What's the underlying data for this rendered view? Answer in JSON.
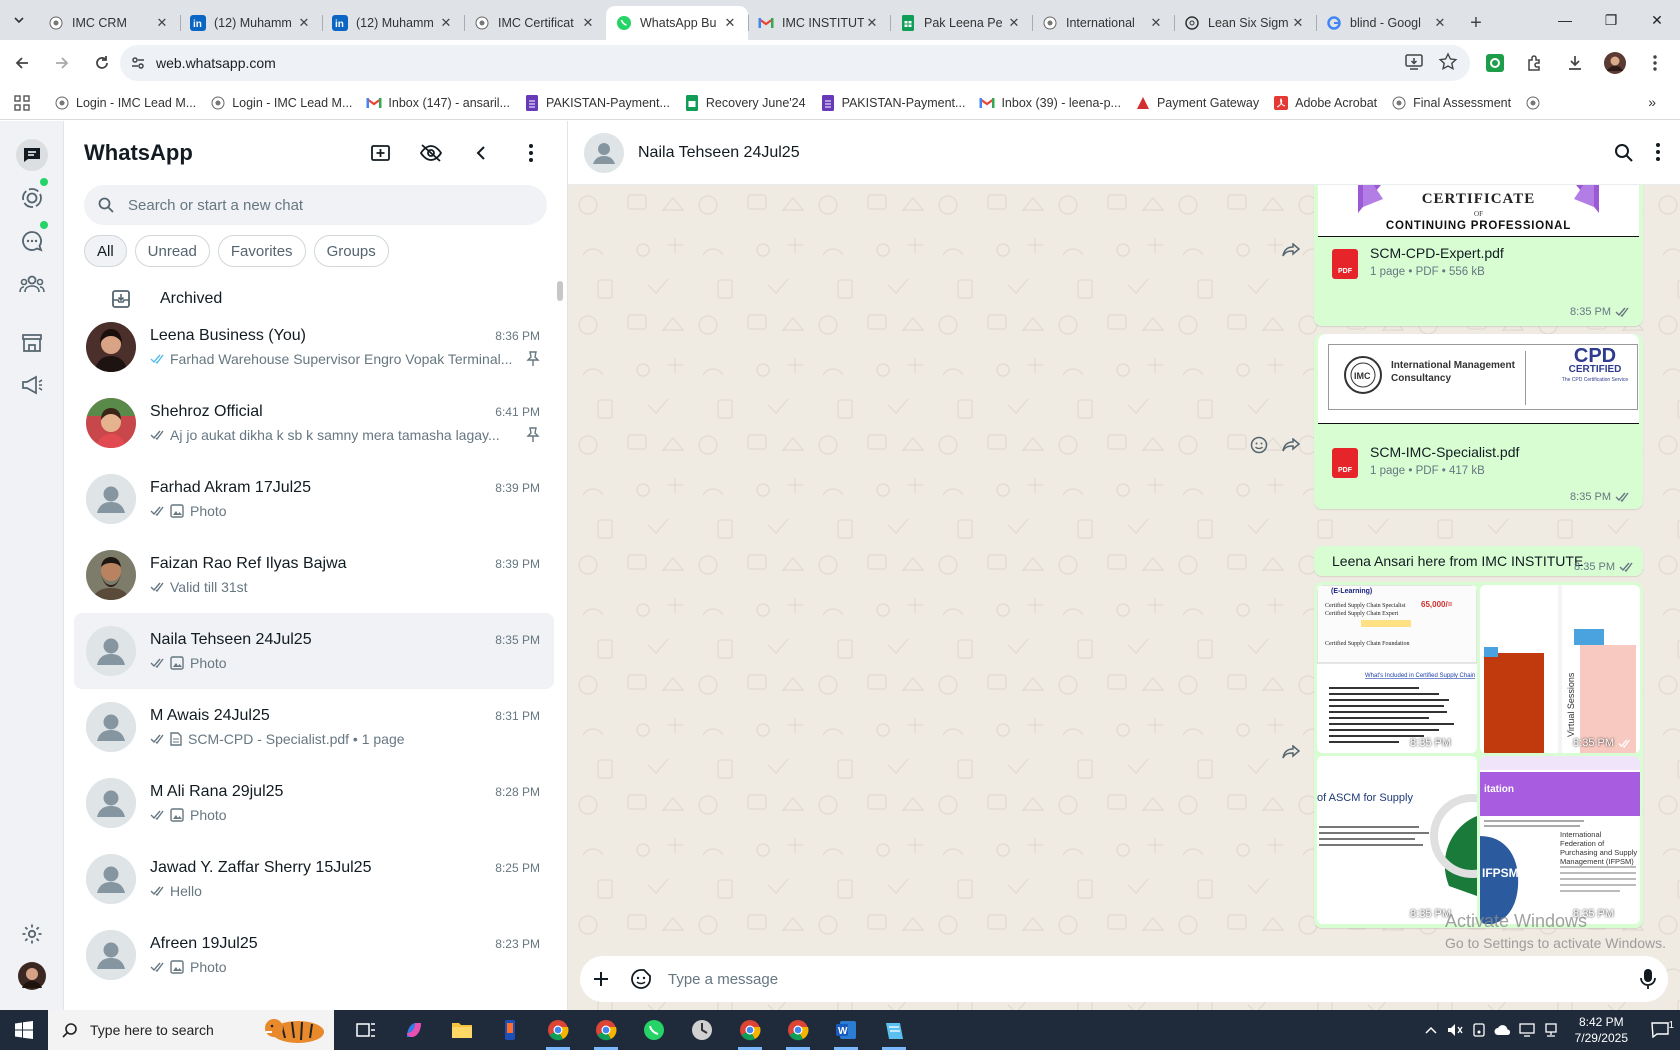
{
  "browser": {
    "tabs": [
      {
        "label": "IMC CRM",
        "icon": "imc-icon"
      },
      {
        "label": "(12) Muhamm",
        "icon": "linkedin-icon"
      },
      {
        "label": "(12) Muhamm",
        "icon": "linkedin-icon"
      },
      {
        "label": "IMC Certificat",
        "icon": "imc-icon"
      },
      {
        "label": "WhatsApp Bu",
        "icon": "whatsapp-icon",
        "active": true
      },
      {
        "label": "IMC INSTITUT",
        "icon": "gmail-icon"
      },
      {
        "label": "Pak Leena Pe",
        "icon": "sheets-icon"
      },
      {
        "label": "International",
        "icon": "imc-icon"
      },
      {
        "label": "Lean Six Sigm",
        "icon": "openai-icon"
      },
      {
        "label": "blind - Googl",
        "icon": "google-icon"
      }
    ],
    "url": "web.whatsapp.com",
    "bookmarks": [
      {
        "label": "Login - IMC Lead M...",
        "icon": "imc-icon"
      },
      {
        "label": "Login - IMC Lead M...",
        "icon": "imc-icon"
      },
      {
        "label": "Inbox (147) - ansaril...",
        "icon": "gmail-icon"
      },
      {
        "label": "PAKISTAN-Payment...",
        "icon": "forms-icon"
      },
      {
        "label": "Recovery June'24",
        "icon": "sheets-icon"
      },
      {
        "label": "PAKISTAN-Payment...",
        "icon": "forms-icon"
      },
      {
        "label": "Inbox (39) - leena-p...",
        "icon": "gmail-icon"
      },
      {
        "label": "Payment Gateway",
        "icon": "gateway-icon"
      },
      {
        "label": "Adobe Acrobat",
        "icon": "acrobat-icon"
      },
      {
        "label": "Final Assessment",
        "icon": "imc-icon"
      }
    ]
  },
  "sidebar": {
    "title": "WhatsApp",
    "search_placeholder": "Search or start a new chat",
    "filters": [
      "All",
      "Unread",
      "Favorites",
      "Groups"
    ],
    "archived_label": "Archived",
    "chats": [
      {
        "name": "Leena Business (You)",
        "time": "8:36 PM",
        "preview": "Farhad Warehouse Supervisor Engro Vopak Terminal...",
        "tick": "blue",
        "media": "",
        "pinned": true,
        "avatar": "photo-woman"
      },
      {
        "name": "Shehroz Official",
        "time": "6:41 PM",
        "preview": "Aj jo aukat dikha k sb k samny mera tamasha lagay...",
        "tick": "grey",
        "media": "",
        "pinned": true,
        "avatar": "photo-child"
      },
      {
        "name": "Farhad Akram 17Jul25",
        "time": "8:39 PM",
        "preview": "Photo",
        "tick": "grey",
        "media": "photo",
        "pinned": false,
        "avatar": "default"
      },
      {
        "name": "Faizan Rao Ref Ilyas Bajwa",
        "time": "8:39 PM",
        "preview": "Valid till 31st",
        "tick": "grey",
        "media": "",
        "pinned": false,
        "avatar": "photo-man"
      },
      {
        "name": "Naila Tehseen 24Jul25",
        "time": "8:35 PM",
        "preview": "Photo",
        "tick": "grey",
        "media": "photo",
        "pinned": false,
        "avatar": "default",
        "selected": true
      },
      {
        "name": "M Awais 24Jul25",
        "time": "8:31 PM",
        "preview": "SCM-CPD - Specialist.pdf • 1 page",
        "tick": "grey",
        "media": "doc",
        "pinned": false,
        "avatar": "default"
      },
      {
        "name": "M Ali Rana 29jul25",
        "time": "8:28 PM",
        "preview": "Photo",
        "tick": "grey",
        "media": "photo",
        "pinned": false,
        "avatar": "default"
      },
      {
        "name": "Jawad Y. Zaffar Sherry 15Jul25",
        "time": "8:25 PM",
        "preview": "Hello",
        "tick": "grey",
        "media": "",
        "pinned": false,
        "avatar": "default"
      },
      {
        "name": "Afreen 19Jul25",
        "time": "8:23 PM",
        "preview": "Photo",
        "tick": "grey",
        "media": "photo",
        "pinned": false,
        "avatar": "default"
      }
    ]
  },
  "conversation": {
    "contact_name": "Naila Tehseen 24Jul25",
    "messages": {
      "doc1": {
        "preview_line1": "CERTIFICATE",
        "preview_line2": "OF",
        "preview_line3": "CONTINUING  PROFESSIONAL",
        "name": "SCM-CPD-Expert.pdf",
        "meta": "1 page • PDF • 556 kB",
        "time": "8:35 PM"
      },
      "doc2": {
        "org_line1": "International Management",
        "org_line2": "Consultancy",
        "badge_top": "CPD",
        "badge_bottom": "CERTIFIED",
        "badge_small": "The CPD Certification Service",
        "name": "SCM-IMC-Specialist.pdf",
        "meta": "1 page • PDF • 417 kB",
        "time": "8:35 PM"
      },
      "text1": {
        "text": "Leena Ansari here from IMC INSTITUTE",
        "time": "8:35 PM"
      },
      "images": [
        {
          "time": "8:35 PM",
          "caption": "(E-Learning)",
          "price": "65,000/="
        },
        {
          "time": "8:35 PM",
          "caption": "Virtual Sessions"
        },
        {
          "time": "8:35 PM",
          "caption": "of ASCM for Supply"
        },
        {
          "time": "8:35 PM",
          "caption": "IFPSM",
          "caption2": "International Federation of Purchasing and Supply Management (IFPSM)",
          "header": "itation"
        }
      ]
    },
    "composer_placeholder": "Type a message",
    "watermark_line1": "Activate Windows",
    "watermark_line2": "Go to Settings to activate Windows."
  },
  "taskbar": {
    "search_placeholder": "Type here to search",
    "time": "8:42 PM",
    "date": "7/29/2025",
    "notification_count": "1"
  },
  "colors": {
    "whatsapp_green": "#25d366",
    "outgoing_bubble": "#d9fdd3",
    "read_tick": "#53bdeb"
  }
}
